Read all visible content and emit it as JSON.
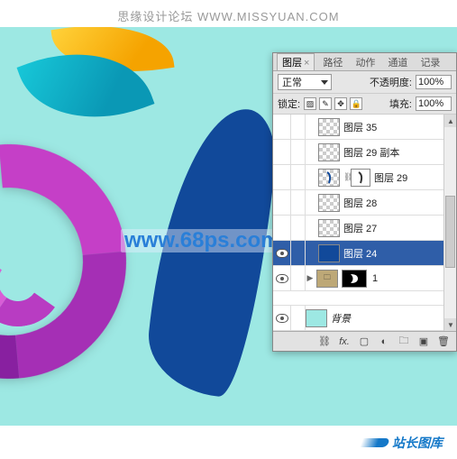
{
  "header": {
    "site_text": "思缘设计论坛 WWW.MISSYUAN.COM"
  },
  "watermark": {
    "text": "www.68ps.com"
  },
  "footer": {
    "text": "站长图库"
  },
  "panel": {
    "tabs": {
      "layers": "图层",
      "paths": "路径",
      "actions": "动作",
      "channels": "通道",
      "history": "记录"
    },
    "blend_label": "正常",
    "opacity_label": "不透明度:",
    "opacity_value": "100%",
    "lock_label": "锁定:",
    "fill_label": "填充:",
    "fill_value": "100%",
    "layers": {
      "l35": "图层 35",
      "l29c": "图层 29 副本",
      "l29": "图层 29",
      "l28": "图层 28",
      "l27": "图层 27",
      "l24": "图层 24",
      "group_mask": "1",
      "bg": "背景"
    },
    "footer_icons": {
      "link": "⛓",
      "fx": "fx.",
      "mask": "▢",
      "adjust": "◐",
      "folder": "🗀",
      "new": "▣",
      "trash": "🗑"
    }
  }
}
